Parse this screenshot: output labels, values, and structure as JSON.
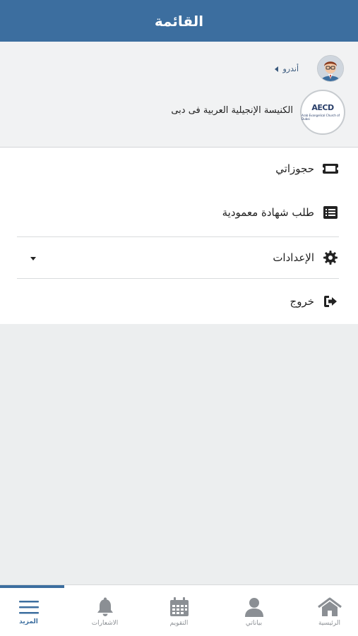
{
  "header": {
    "title": "القائمة"
  },
  "profile": {
    "user_name": "أندرو",
    "church_name": "الكنيسة الإنجيلية العربية فى دبى",
    "logo_text": "AECD",
    "logo_subtext": "Arab Evangelical Church of Dubai"
  },
  "menu": {
    "items": [
      {
        "label": "حجوزاتي",
        "icon": "ticket-icon"
      },
      {
        "label": "طلب شهادة معمودية",
        "icon": "list-alt-icon"
      },
      {
        "label": "الإعدادات",
        "icon": "gear-icon"
      },
      {
        "label": "خروج",
        "icon": "sign-out-icon"
      }
    ]
  },
  "tabs": [
    {
      "label": "المزيد",
      "icon": "bars-icon",
      "active": true
    },
    {
      "label": "الاشعارات",
      "icon": "bell-icon",
      "active": false
    },
    {
      "label": "التقويم",
      "icon": "calendar-icon",
      "active": false
    },
    {
      "label": "بياناتي",
      "icon": "user-icon",
      "active": false
    },
    {
      "label": "الرئيسية",
      "icon": "home-icon",
      "active": false
    }
  ],
  "colors": {
    "primary": "#3c6e9f",
    "background": "#eceeef",
    "inactive": "#8b8f94"
  }
}
